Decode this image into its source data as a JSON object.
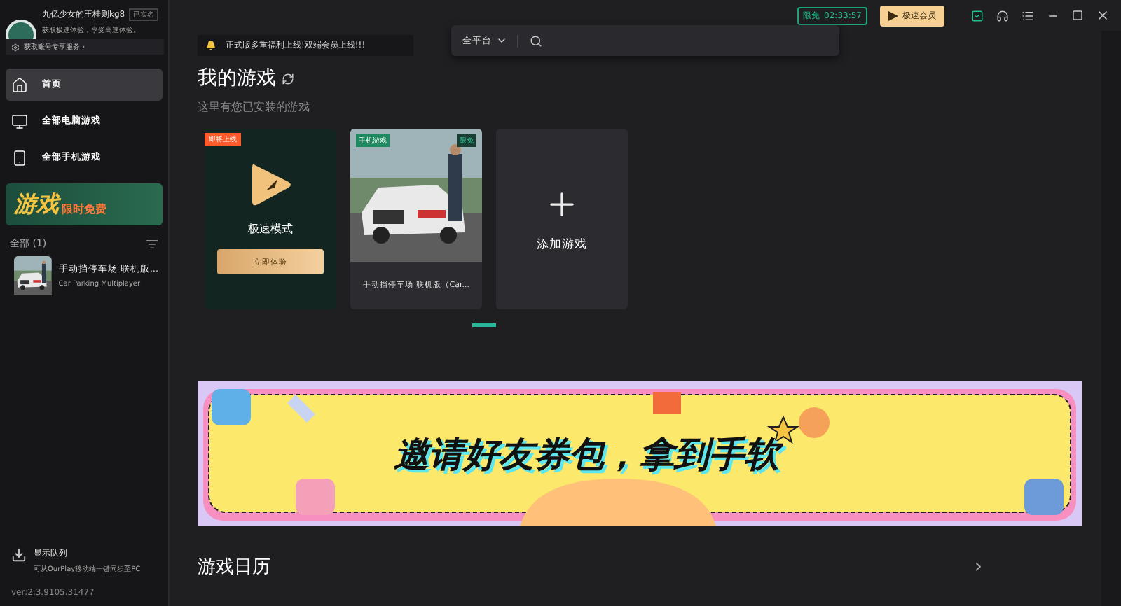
{
  "profile": {
    "name": "九亿少女的王桂则kg8",
    "tag": "已实名",
    "tagline": "获取极速体验，享受高速体验。",
    "service_button": "获取账号专享服务 ›"
  },
  "sidebar": {
    "items": [
      {
        "label": "首页",
        "selected": true
      },
      {
        "label": "全部电脑游戏",
        "selected": false
      },
      {
        "label": "全部手机游戏",
        "selected": false
      }
    ],
    "promo": {
      "title": "游戏",
      "highlight": "限时免费"
    },
    "library_heading": "全部 (1)",
    "library": [
      {
        "title": "手动挡停车场 联机版...",
        "subtitle": "Car Parking Multiplayer"
      }
    ],
    "queue": {
      "title": "显示队列",
      "description": "可从OurPlay移动端一键同步至PC"
    },
    "version": "ver:2.3.9105.31477"
  },
  "topbar": {
    "free_label": "限免",
    "timer": "02:33:57",
    "vip_button": "极速会员",
    "notice": "正式版多重福利上线!双端会员上线!!!",
    "platform": "全平台"
  },
  "my_games": {
    "title": "我的游戏",
    "subtitle": "这里有您已安装的游戏",
    "cards": [
      {
        "kind": "promo",
        "badge": "即将上线",
        "title": "极速模式",
        "button": "立即体验"
      },
      {
        "kind": "game",
        "badge": "手机游戏",
        "badge_right": "限免",
        "title": "手动挡停车场 联机版（Car..."
      },
      {
        "kind": "add",
        "title": "添加游戏"
      }
    ]
  },
  "banner": {
    "text": "邀请好友券包，拿到手软"
  },
  "calendar": {
    "title": "游戏日历",
    "more": "›"
  }
}
